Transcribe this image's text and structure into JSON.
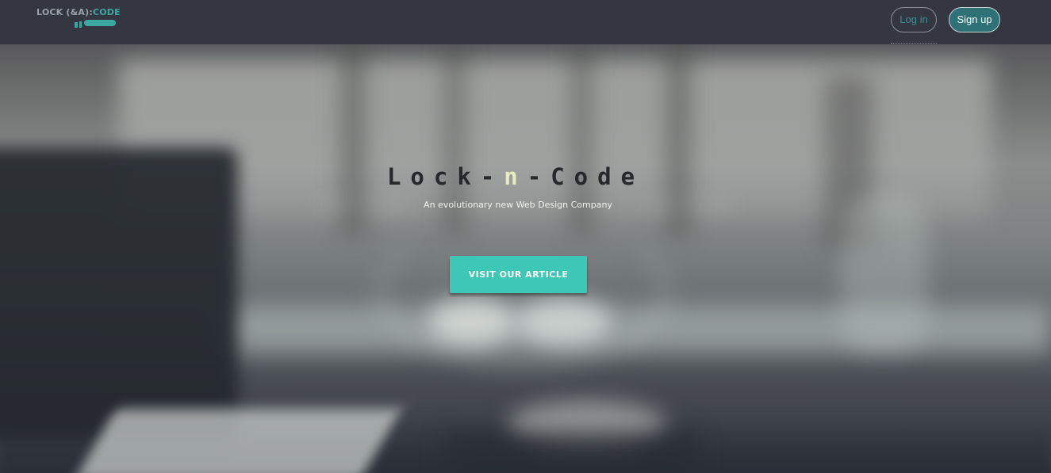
{
  "header": {
    "logo": {
      "text_left": "LOCK (&A):",
      "text_right": "CODE"
    },
    "login_label": "Log in",
    "signup_label": "Sign up"
  },
  "hero": {
    "title_left": "Lock-",
    "title_mid": "n",
    "title_right": "-Code",
    "subtitle": "An evolutionary new Web Design Company",
    "cta_label": "VISIT OUR ARTICLE"
  },
  "colors": {
    "header_bg": "#343741",
    "accent_teal": "#3dc7b6",
    "signup_bg": "#2e7277"
  }
}
